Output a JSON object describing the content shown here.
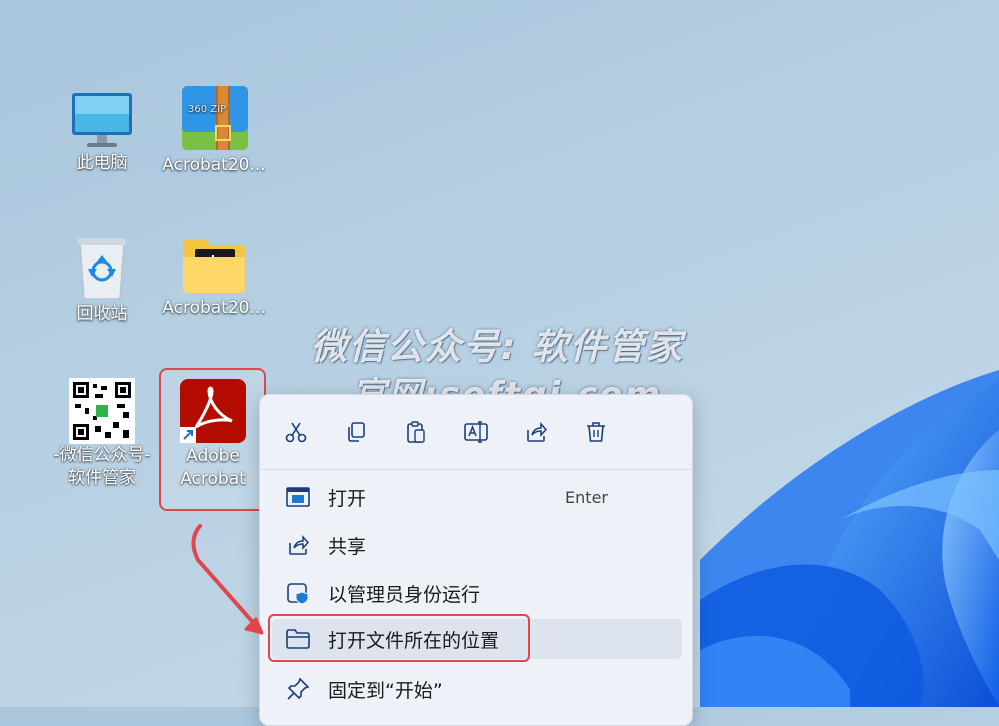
{
  "desktop": {
    "icons": [
      {
        "label": "此电脑",
        "icon": "monitor-icon"
      },
      {
        "label": "Acrobat20...",
        "icon": "zip-archive-icon"
      },
      {
        "label": "回收站",
        "icon": "recycle-bin-icon"
      },
      {
        "label": "Acrobat20...",
        "icon": "folder-icon"
      },
      {
        "label": "-微信公众号-",
        "label2": "软件管家",
        "icon": "qr-code-icon"
      },
      {
        "label": "Adobe",
        "label2": "Acrobat",
        "icon": "adobe-acrobat-icon"
      }
    ],
    "zip_badge": "360 ZIP"
  },
  "watermark": {
    "line1": "微信公众号: 软件管家",
    "line2": "官网:softgj.com"
  },
  "context_menu": {
    "toolbar": [
      {
        "name": "cut",
        "icon": "scissors-icon"
      },
      {
        "name": "copy",
        "icon": "copy-icon"
      },
      {
        "name": "paste",
        "icon": "clipboard-icon"
      },
      {
        "name": "rename",
        "icon": "rename-icon"
      },
      {
        "name": "share",
        "icon": "share-icon"
      },
      {
        "name": "delete",
        "icon": "trash-icon"
      }
    ],
    "items": [
      {
        "label": "打开",
        "shortcut": "Enter",
        "icon": "open-app-icon"
      },
      {
        "label": "共享",
        "icon": "share-icon"
      },
      {
        "label": "以管理员身份运行",
        "icon": "shield-admin-icon"
      },
      {
        "label": "打开文件所在的位置",
        "icon": "folder-outline-icon"
      },
      {
        "label": "固定到“开始”",
        "icon": "pin-icon"
      }
    ]
  },
  "colors": {
    "highlight_red": "#e0474c",
    "acrobat_red": "#b30b00",
    "menu_bg": "#eef2f8"
  }
}
